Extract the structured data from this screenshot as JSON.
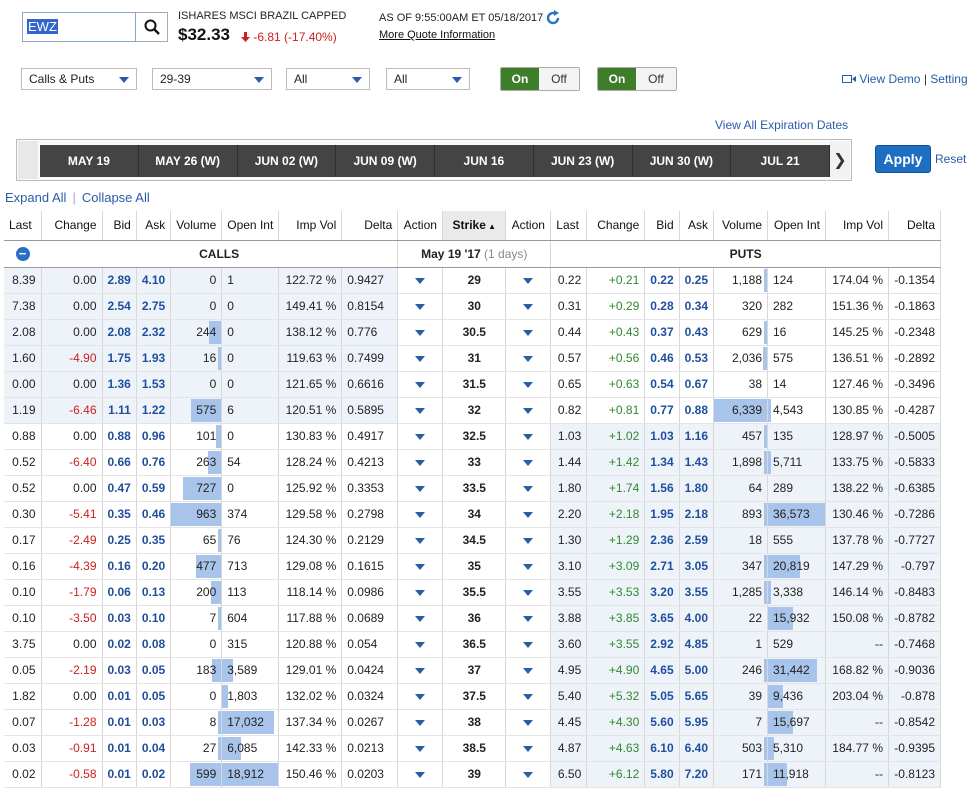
{
  "header": {
    "symbol": "EWZ",
    "name": "ISHARES MSCI BRAZIL CAPPED",
    "price": "$32.33",
    "change": "-6.81 (-17.40%)",
    "as_of": "AS OF 9:55:00AM ET 05/18/2017",
    "more_quote": "More Quote Information"
  },
  "controls": {
    "type_select": "Calls & Puts",
    "strike_range": "29-39",
    "filter1": "All",
    "filter2": "All",
    "toggle1": {
      "on": "On",
      "off": "Off"
    },
    "toggle2": {
      "on": "On",
      "off": "Off"
    },
    "view_demo": "View Demo",
    "settings": "Setting"
  },
  "expirations": {
    "view_all": "View All Expiration Dates",
    "tabs": [
      "MAY 19",
      "MAY 26 (W)",
      "JUN 02 (W)",
      "JUN 09 (W)",
      "JUN 16",
      "JUN 23 (W)",
      "JUN 30 (W)",
      "JUL 21"
    ],
    "apply": "Apply",
    "reset": "Reset"
  },
  "expand_all": "Expand All",
  "collapse_all": "Collapse All",
  "table": {
    "columns": [
      "Last",
      "Change",
      "Bid",
      "Ask",
      "Volume",
      "Open Int",
      "Imp Vol",
      "Delta",
      "Action",
      "Strike",
      "Action",
      "Last",
      "Change",
      "Bid",
      "Ask",
      "Volume",
      "Open Int",
      "Imp Vol",
      "Delta"
    ],
    "calls_label": "CALLS",
    "puts_label": "PUTS",
    "expiry_label": "May 19 '17",
    "days_label": "(1 days)",
    "rows": [
      {
        "c": [
          "8.39",
          "0.00",
          "2.89",
          "4.10",
          "0",
          "1",
          "122.72 %",
          "0.9427"
        ],
        "strike": "29",
        "p": [
          "0.22",
          "+0.21",
          "0.22",
          "0.25",
          "1,188",
          "124",
          "174.04 %",
          "-0.1354"
        ],
        "cvol": 0,
        "coi": 0.0,
        "pvol": 0.04,
        "poi": 0.0
      },
      {
        "c": [
          "7.38",
          "0.00",
          "2.54",
          "2.75",
          "0",
          "0",
          "149.41 %",
          "0.8154"
        ],
        "strike": "30",
        "p": [
          "0.31",
          "+0.29",
          "0.28",
          "0.34",
          "320",
          "282",
          "151.36 %",
          "-0.1863"
        ],
        "cvol": 0,
        "coi": 0,
        "pvol": 0.0,
        "poi": 0.0
      },
      {
        "c": [
          "2.08",
          "0.00",
          "2.08",
          "2.32",
          "244",
          "0",
          "138.12 %",
          "0.776"
        ],
        "strike": "30.5",
        "p": [
          "0.44",
          "+0.43",
          "0.37",
          "0.43",
          "629",
          "16",
          "145.25 %",
          "-0.2348"
        ],
        "cvol": 0.25,
        "coi": 0,
        "pvol": 0.02,
        "poi": 0
      },
      {
        "c": [
          "1.60",
          "-4.90",
          "1.75",
          "1.93",
          "16",
          "0",
          "119.63 %",
          "0.7499"
        ],
        "strike": "31",
        "p": [
          "0.57",
          "+0.56",
          "0.46",
          "0.53",
          "2,036",
          "575",
          "136.51 %",
          "-0.2892"
        ],
        "cvol": 0.02,
        "coi": 0,
        "pvol": 0.08,
        "poi": 0.0
      },
      {
        "c": [
          "0.00",
          "0.00",
          "1.36",
          "1.53",
          "0",
          "0",
          "121.65 %",
          "0.6616"
        ],
        "strike": "31.5",
        "p": [
          "0.65",
          "+0.63",
          "0.54",
          "0.67",
          "38",
          "14",
          "127.46 %",
          "-0.3496"
        ],
        "cvol": 0,
        "coi": 0,
        "pvol": 0,
        "poi": 0
      },
      {
        "c": [
          "1.19",
          "-6.46",
          "1.11",
          "1.22",
          "575",
          "6",
          "120.51 %",
          "0.5895"
        ],
        "strike": "32",
        "p": [
          "0.82",
          "+0.81",
          "0.77",
          "0.88",
          "6,339",
          "4,543",
          "130.85 %",
          "-0.4287"
        ],
        "cvol": 0.6,
        "coi": 0,
        "pvol": 1.0,
        "poi": 0.03
      },
      {
        "c": [
          "0.88",
          "0.00",
          "0.88",
          "0.96",
          "101",
          "0",
          "130.83 %",
          "0.4917"
        ],
        "strike": "32.5",
        "p": [
          "1.03",
          "+1.02",
          "1.03",
          "1.16",
          "457",
          "135",
          "128.97 %",
          "-0.5005"
        ],
        "cvol": 0.1,
        "coi": 0,
        "pvol": 0.02,
        "poi": 0
      },
      {
        "c": [
          "0.52",
          "-6.40",
          "0.66",
          "0.76",
          "263",
          "54",
          "128.24 %",
          "0.4213"
        ],
        "strike": "33",
        "p": [
          "1.44",
          "+1.42",
          "1.34",
          "1.43",
          "1,898",
          "5,711",
          "133.75 %",
          "-0.5833"
        ],
        "cvol": 0.27,
        "coi": 0,
        "pvol": 0.06,
        "poi": 0.06
      },
      {
        "c": [
          "0.52",
          "0.00",
          "0.47",
          "0.59",
          "727",
          "0",
          "125.92 %",
          "0.3353"
        ],
        "strike": "33.5",
        "p": [
          "1.80",
          "+1.74",
          "1.56",
          "1.80",
          "64",
          "289",
          "138.22 %",
          "-0.6385"
        ],
        "cvol": 0.76,
        "coi": 0,
        "pvol": 0,
        "poi": 0
      },
      {
        "c": [
          "0.30",
          "-5.41",
          "0.35",
          "0.46",
          "963",
          "374",
          "129.58 %",
          "0.2798"
        ],
        "strike": "34",
        "p": [
          "2.20",
          "+2.18",
          "1.95",
          "2.18",
          "893",
          "36,573",
          "130.46 %",
          "-0.7286"
        ],
        "cvol": 1.0,
        "coi": 0,
        "pvol": 0.03,
        "poi": 1.0
      },
      {
        "c": [
          "0.17",
          "-2.49",
          "0.25",
          "0.35",
          "65",
          "76",
          "124.30 %",
          "0.2129"
        ],
        "strike": "34.5",
        "p": [
          "1.30",
          "+1.29",
          "2.36",
          "2.59",
          "18",
          "555",
          "137.78 %",
          "-0.7727"
        ],
        "cvol": 0.07,
        "coi": 0,
        "pvol": 0,
        "poi": 0
      },
      {
        "c": [
          "0.16",
          "-4.39",
          "0.16",
          "0.20",
          "477",
          "713",
          "129.08 %",
          "0.1615"
        ],
        "strike": "35",
        "p": [
          "3.10",
          "+3.09",
          "2.71",
          "3.05",
          "347",
          "20,819",
          "147.29 %",
          "-0.797"
        ],
        "cvol": 0.5,
        "coi": 0,
        "pvol": 0.02,
        "poi": 0.57
      },
      {
        "c": [
          "0.10",
          "-1.79",
          "0.06",
          "0.13",
          "200",
          "113",
          "118.14 %",
          "0.0986"
        ],
        "strike": "35.5",
        "p": [
          "3.55",
          "+3.53",
          "3.20",
          "3.55",
          "1,285",
          "3,338",
          "146.14 %",
          "-0.8483"
        ],
        "cvol": 0.2,
        "coi": 0,
        "pvol": 0.02,
        "poi": 0.04
      },
      {
        "c": [
          "0.10",
          "-3.50",
          "0.03",
          "0.10",
          "7",
          "604",
          "117.88 %",
          "0.0689"
        ],
        "strike": "36",
        "p": [
          "3.88",
          "+3.85",
          "3.65",
          "4.00",
          "22",
          "15,932",
          "150.08 %",
          "-0.8782"
        ],
        "cvol": 0.01,
        "coi": 0.0,
        "pvol": 0,
        "poi": 0.43
      },
      {
        "c": [
          "3.75",
          "0.00",
          "0.02",
          "0.08",
          "0",
          "315",
          "120.88 %",
          "0.054"
        ],
        "strike": "36.5",
        "p": [
          "3.60",
          "+3.55",
          "2.92",
          "4.85",
          "1",
          "529",
          "--",
          "-0.7468"
        ],
        "cvol": 0,
        "coi": 0,
        "pvol": 0,
        "poi": 0.0
      },
      {
        "c": [
          "0.05",
          "-2.19",
          "0.03",
          "0.05",
          "183",
          "3,589",
          "129.01 %",
          "0.0424"
        ],
        "strike": "37",
        "p": [
          "4.95",
          "+4.90",
          "4.65",
          "5.00",
          "246",
          "31,442",
          "168.82 %",
          "-0.9036"
        ],
        "cvol": 0.19,
        "coi": 0.2,
        "pvol": 0.02,
        "poi": 0.86
      },
      {
        "c": [
          "1.82",
          "0.00",
          "0.01",
          "0.05",
          "0",
          "1,803",
          "132.02 %",
          "0.0324"
        ],
        "strike": "37.5",
        "p": [
          "5.40",
          "+5.32",
          "5.05",
          "5.65",
          "39",
          "9,436",
          "203.04 %",
          "-0.878"
        ],
        "cvol": 0,
        "coi": 0.1,
        "pvol": 0,
        "poi": 0.26
      },
      {
        "c": [
          "0.07",
          "-1.28",
          "0.01",
          "0.03",
          "8",
          "17,032",
          "137.34 %",
          "0.0267"
        ],
        "strike": "38",
        "p": [
          "4.45",
          "+4.30",
          "5.60",
          "5.95",
          "7",
          "15,697",
          "--",
          "-0.8542"
        ],
        "cvol": 0.01,
        "coi": 0.93,
        "pvol": 0,
        "poi": 0.43
      },
      {
        "c": [
          "0.03",
          "-0.91",
          "0.01",
          "0.04",
          "27",
          "6,085",
          "142.33 %",
          "0.0213"
        ],
        "strike": "38.5",
        "p": [
          "4.87",
          "+4.63",
          "6.10",
          "6.40",
          "503",
          "5,310",
          "184.77 %",
          "-0.9395"
        ],
        "cvol": 0.03,
        "coi": 0.33,
        "pvol": 0.02,
        "poi": 0.1
      },
      {
        "c": [
          "0.02",
          "-0.58",
          "0.01",
          "0.02",
          "599",
          "18,912",
          "150.46 %",
          "0.0203"
        ],
        "strike": "39",
        "p": [
          "6.50",
          "+6.12",
          "5.80",
          "7.20",
          "171",
          "11,918",
          "--",
          "-0.8123"
        ],
        "cvol": 0.62,
        "coi": 1.0,
        "pvol": 0.01,
        "poi": 0.33
      }
    ]
  },
  "colors": {
    "accent": "#2a5ca8",
    "down": "#cc2020",
    "up": "#2f8a2f",
    "on": "#3e7d2a",
    "bar": "#a9c4ea"
  }
}
